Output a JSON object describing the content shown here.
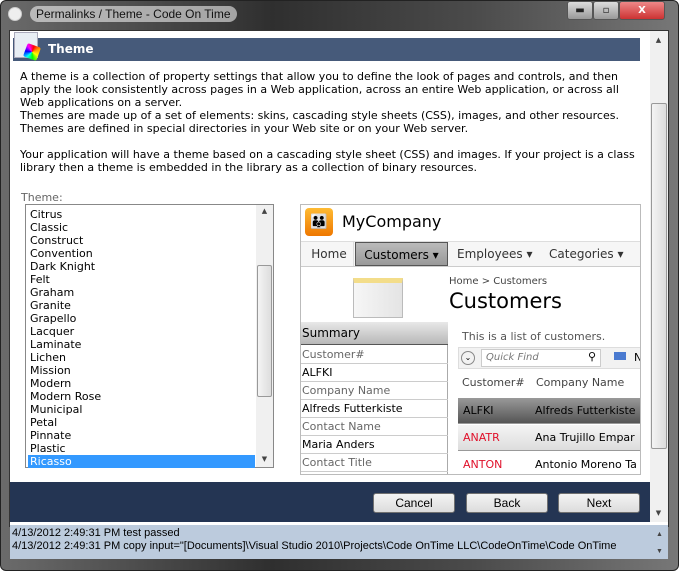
{
  "window": {
    "title": "Permalinks / Theme - Code On Time",
    "min": "▬",
    "max": "▫",
    "close": "X"
  },
  "header": {
    "title": "Theme"
  },
  "paragraphs": [
    "A theme is a collection of property settings that allow you to define the look of pages and controls, and then apply the look consistently across pages in a Web application, across an entire Web application, or across all Web applications on a server.",
    "Themes are made up of a set of elements: skins, cascading style sheets (CSS), images, and other resources. Themes are defined in special directories in your Web site or on your Web server.",
    "Your application will have a theme based on a cascading style sheet (CSS) and images. If your project is a class library then a theme is embedded in the library as a collection of binary resources."
  ],
  "theme": {
    "label": "Theme:",
    "items": [
      "Citrus",
      "Classic",
      "Construct",
      "Convention",
      "Dark Knight",
      "Felt",
      "Graham",
      "Granite",
      "Grapello",
      "Lacquer",
      "Laminate",
      "Lichen",
      "Mission",
      "Modern",
      "Modern Rose",
      "Municipal",
      "Petal",
      "Pinnate",
      "Plastic",
      "Ricasso"
    ],
    "selected": "Ricasso"
  },
  "preview": {
    "company": "MyCompany",
    "menu": [
      "Home",
      "Customers ▾",
      "Employees ▾",
      "Categories ▾"
    ],
    "breadcrumb": "Home  >  Customers",
    "page_title": "Customers",
    "summary": {
      "title": "Summary",
      "rows": [
        "Customer#",
        "ALFKI",
        "Company Name",
        "Alfreds Futterkiste",
        "Contact Name",
        "Maria Anders",
        "Contact Title"
      ]
    },
    "description": "This is a list of customers.",
    "quick_find": "Quick Find",
    "toolbar_new": "N",
    "columns": [
      "Customer#",
      "Company Name"
    ],
    "rows": [
      [
        "ALFKI",
        "Alfreds Futterkiste"
      ],
      [
        "ANATR",
        "Ana Trujillo Empar"
      ],
      [
        "ANTON",
        "Antonio Moreno Ta"
      ]
    ]
  },
  "buttons": {
    "cancel": "Cancel",
    "back": "Back",
    "next": "Next"
  },
  "log": [
    "4/13/2012 2:49:31 PM test passed",
    "4/13/2012 2:49:31 PM copy input=\"[Documents]\\Visual Studio 2010\\Projects\\Code OnTime LLC\\CodeOnTime\\Code OnTime"
  ]
}
